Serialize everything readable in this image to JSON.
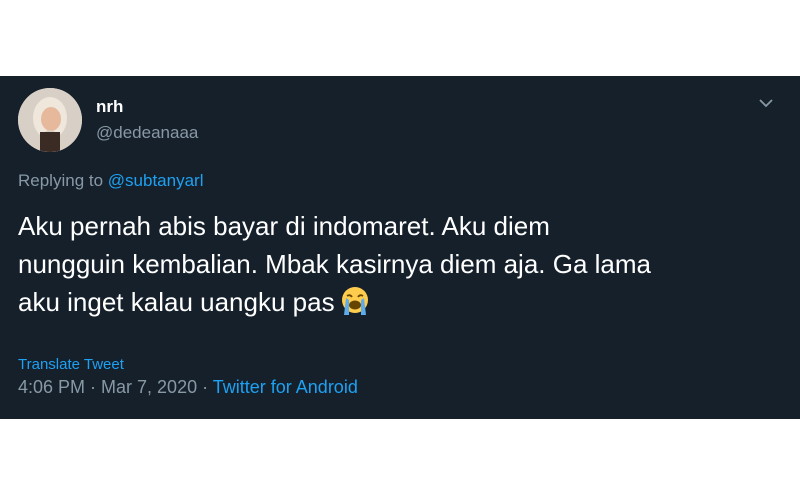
{
  "tweet": {
    "display_name": "nrh",
    "handle": "@dedeanaaa",
    "reply_prefix": "Replying to",
    "reply_mention": "@subtanyarl",
    "text_line1": "Aku pernah abis bayar di indomaret. Aku diem",
    "text_line2": "nungguin kembalian. Mbak kasirnya diem aja. Ga lama",
    "text_line3": "aku inget kalau uangku pas",
    "emoji": "loudly-crying-face-icon",
    "translate_label": "Translate Tweet",
    "timestamp": "4:06 PM · Mar 7, 2020",
    "separator": " · ",
    "source": "Twitter for Android"
  },
  "colors": {
    "background": "#15202b",
    "accent": "#1da1f2",
    "secondary_text": "#8899a6"
  }
}
